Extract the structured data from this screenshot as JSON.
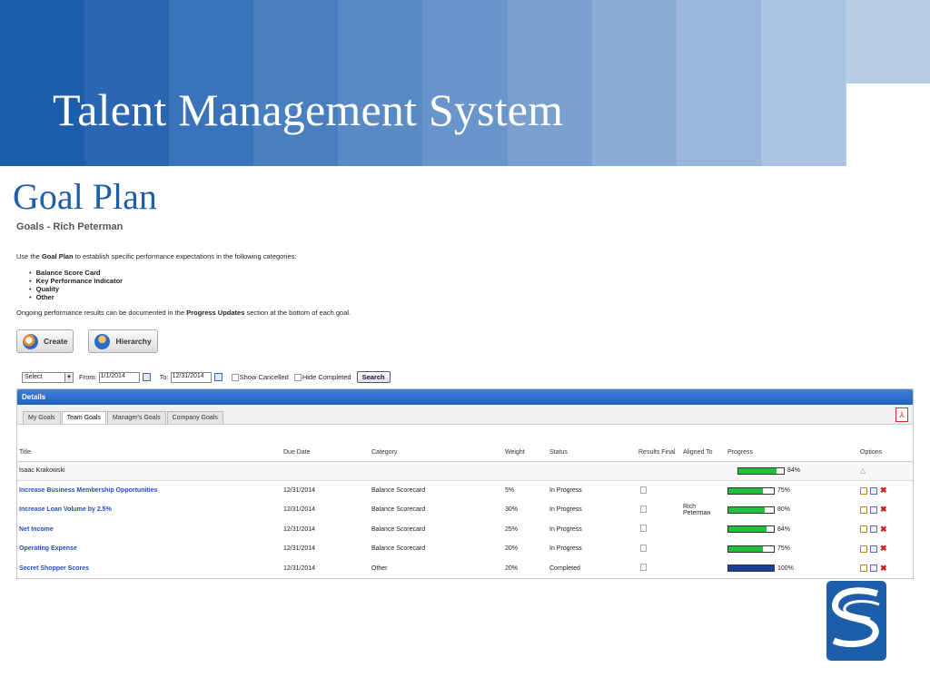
{
  "slide": {
    "title": "Talent Management System",
    "subtitle": "Goal Plan",
    "banner_colors": [
      "#1d5eab",
      "#2a66b1",
      "#3a73b9",
      "#4a7fbf",
      "#5a8ac4",
      "#6995ca",
      "#7aa0cf",
      "#8aacd5",
      "#99b7da",
      "#aac3e0",
      "#b7cce5"
    ]
  },
  "app": {
    "heading": "Goals - Rich Peterman",
    "intro": {
      "before": "Use the ",
      "strong": "Goal Plan",
      "after": " to establish specific performance expectations in the following categories:"
    },
    "categories": [
      "Balance Score Card",
      "Key Performance Indicator",
      "Quality",
      "Other"
    ],
    "progress_note": {
      "before": "Ongoing performance results can be documented in the ",
      "strong": "Progress Updates",
      "after": " section at the bottom of each goal."
    },
    "buttons": {
      "create": "Create",
      "hierarchy": "Hierarchy"
    },
    "filters": {
      "select_value": "Select",
      "from_label": "From:",
      "from_value": "1/1/2014",
      "to_label": "To:",
      "to_value": "12/31/2014",
      "show_cancelled": "Show Cancelled",
      "hide_completed": "Hide Completed",
      "search": "Search"
    },
    "panel": {
      "title": "Details",
      "tabs": [
        "My Goals",
        "Team Goals",
        "Manager's Goals",
        "Company Goals"
      ],
      "active_tab": "Team Goals"
    },
    "table": {
      "columns": [
        "Title",
        "Due Date",
        "Category",
        "Weight",
        "Status",
        "Results Final",
        "Aligned To",
        "Progress",
        "Options"
      ],
      "group": {
        "name": "Isaac Krakowski",
        "progress": 84,
        "progress_label": "84%"
      },
      "rows": [
        {
          "title": "Increase Business Membership Opportunities",
          "due": "12/31/2014",
          "category": "Balance Scorecard",
          "weight": "5%",
          "status": "In Progress",
          "aligned": "",
          "progress": 75,
          "progress_label": "75%",
          "color": "#1fc23a"
        },
        {
          "title": "Increase Loan Volume by 2.5%",
          "due": "12/31/2014",
          "category": "Balance Scorecard",
          "weight": "30%",
          "status": "In Progress",
          "aligned": "Rich Peterman",
          "progress": 80,
          "progress_label": "80%",
          "color": "#1fc23a"
        },
        {
          "title": "Net Income",
          "due": "12/31/2014",
          "category": "Balance Scorecard",
          "weight": "25%",
          "status": "In Progress",
          "aligned": "",
          "progress": 84,
          "progress_label": "84%",
          "color": "#1fc23a"
        },
        {
          "title": "Operating Expense",
          "due": "12/31/2014",
          "category": "Balance Scorecard",
          "weight": "20%",
          "status": "In Progress",
          "aligned": "",
          "progress": 75,
          "progress_label": "75%",
          "color": "#1fc23a"
        },
        {
          "title": "Secret Shopper Scores",
          "due": "12/31/2014",
          "category": "Other",
          "weight": "20%",
          "status": "Completed",
          "aligned": "",
          "progress": 100,
          "progress_label": "100%",
          "color": "#1a3f9c"
        }
      ]
    }
  },
  "icons": {
    "create": "create-icon",
    "hierarchy": "hierarchy-icon",
    "calendar": "calendar-icon",
    "pdf": "pdf-icon",
    "edit": "edit-icon",
    "copy": "copy-icon",
    "delete": "delete-icon"
  },
  "logo_colors": [
    "#1d5eab",
    "#ffffff"
  ]
}
